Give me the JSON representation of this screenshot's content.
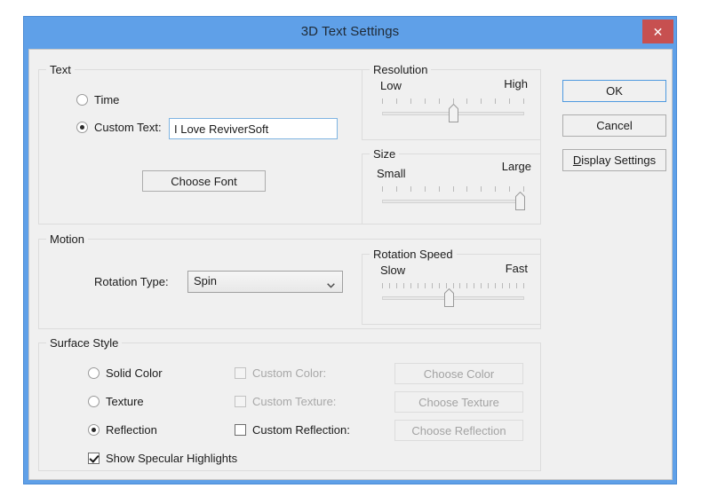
{
  "window": {
    "title": "3D Text Settings",
    "close_label": "✕",
    "accent_color": "#5fa0e8",
    "close_color": "#c75050"
  },
  "groups": {
    "text": {
      "legend": "Text"
    },
    "resolution": {
      "legend": "Resolution"
    },
    "size": {
      "legend": "Size"
    },
    "motion": {
      "legend": "Motion"
    },
    "rotation_speed": {
      "legend": "Rotation Speed"
    },
    "surface_style": {
      "legend": "Surface Style"
    }
  },
  "text_group": {
    "time_radio": {
      "label": "Time",
      "checked": false
    },
    "custom_text_radio": {
      "label": "Custom Text:",
      "checked": true
    },
    "custom_text_input": {
      "value": "I Love ReviverSoft",
      "placeholder": ""
    },
    "choose_font_button": {
      "label": "Choose Font",
      "enabled": true
    }
  },
  "resolution_slider": {
    "min_label": "Low",
    "max_label": "High",
    "ticks": 11,
    "value_percent": 50
  },
  "size_slider": {
    "min_label": "Small",
    "max_label": "Large",
    "ticks": 11,
    "value_percent": 97
  },
  "motion_group": {
    "rotation_type_label": "Rotation Type:",
    "rotation_type_value": "Spin",
    "rotation_type_options": [
      "Spin"
    ]
  },
  "rotation_speed_slider": {
    "min_label": "Slow",
    "max_label": "Fast",
    "ticks": 21,
    "value_percent": 47
  },
  "surface_style": {
    "solid_color_radio": {
      "label": "Solid Color",
      "checked": false
    },
    "texture_radio": {
      "label": "Texture",
      "checked": false
    },
    "reflection_radio": {
      "label": "Reflection",
      "checked": true
    },
    "specular_checkbox": {
      "label": "Show Specular Highlights",
      "checked": true
    },
    "custom_color_checkbox": {
      "label": "Custom Color:",
      "checked": false,
      "enabled": false
    },
    "custom_texture_checkbox": {
      "label": "Custom Texture:",
      "checked": false,
      "enabled": false
    },
    "custom_reflection_checkbox": {
      "label": "Custom Reflection:",
      "checked": false,
      "enabled": true
    },
    "choose_color_button": {
      "label": "Choose Color",
      "enabled": false
    },
    "choose_texture_button": {
      "label": "Choose Texture",
      "enabled": false
    },
    "choose_reflection_button": {
      "label": "Choose Reflection",
      "enabled": false
    }
  },
  "action_buttons": {
    "ok": {
      "label": "OK",
      "is_default": true
    },
    "cancel": {
      "label": "Cancel"
    },
    "display_settings": {
      "label": "Display Settings",
      "accelerator": "D"
    }
  }
}
